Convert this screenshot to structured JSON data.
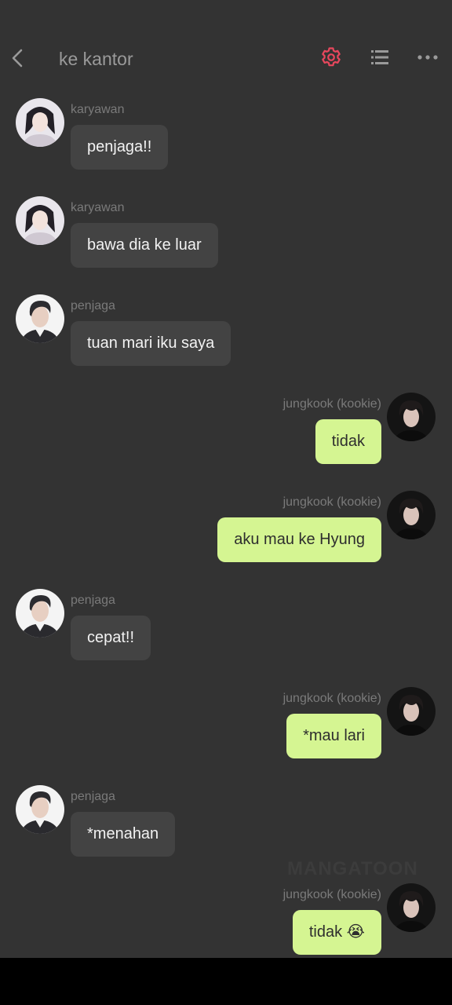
{
  "header": {
    "title": "ke kantor",
    "icons": [
      "chevron-left-icon",
      "gear-icon",
      "list-icon",
      "more-icon"
    ],
    "accent_color": "#e8475d"
  },
  "colors": {
    "background": "#333333",
    "bubble_left": "#434343",
    "bubble_right": "#d5f592",
    "sender_text": "#7a7a7a"
  },
  "messages": [
    {
      "side": "left",
      "sender": "karyawan",
      "text": "penjaga!!",
      "avatar": "karyawan-avatar"
    },
    {
      "side": "left",
      "sender": "karyawan",
      "text": "bawa dia ke luar",
      "avatar": "karyawan-avatar"
    },
    {
      "side": "left",
      "sender": "penjaga",
      "text": "tuan mari iku saya",
      "avatar": "penjaga-avatar"
    },
    {
      "side": "right",
      "sender": "jungkook (kookie)",
      "text": "tidak",
      "avatar": "jungkook-avatar"
    },
    {
      "side": "right",
      "sender": "jungkook (kookie)",
      "text": "aku mau ke Hyung",
      "avatar": "jungkook-avatar"
    },
    {
      "side": "left",
      "sender": "penjaga",
      "text": "cepat!!",
      "avatar": "penjaga-avatar"
    },
    {
      "side": "right",
      "sender": "jungkook (kookie)",
      "text": "*mau lari",
      "avatar": "jungkook-avatar"
    },
    {
      "side": "left",
      "sender": "penjaga",
      "text": "*menahan",
      "avatar": "penjaga-avatar"
    },
    {
      "side": "right",
      "sender": "jungkook (kookie)",
      "text": "tidak 😭",
      "avatar": "jungkook-avatar"
    }
  ],
  "watermark": "MANGATOON"
}
